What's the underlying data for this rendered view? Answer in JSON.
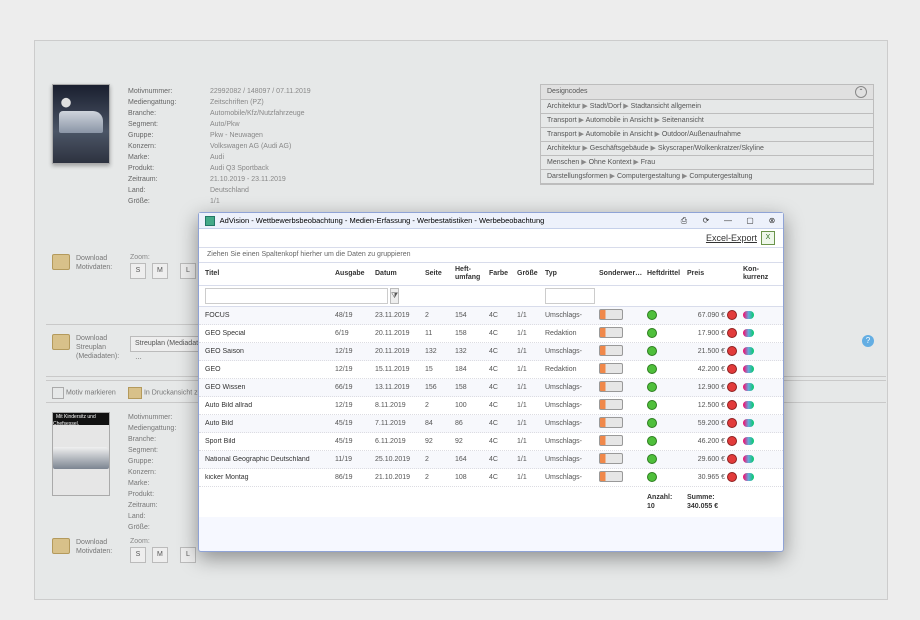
{
  "meta": {
    "labels": [
      "Motivnummer:",
      "Mediengattung:",
      "Branche:",
      "Segment:",
      "Gruppe:",
      "Konzern:",
      "Marke:",
      "Produkt:",
      "Zeitraum:",
      "Land:",
      "Größe:"
    ],
    "values": [
      "22992082 / 148097 / 07.11.2019",
      "Zeitschriften (PZ)",
      "Automobile/Kfz/Nutzfahrzeuge",
      "Auto/Pkw",
      "Pkw - Neuwagen",
      "Volkswagen AG (Audi AG)",
      "Audi",
      "Audi Q3 Sportback",
      "21.10.2019 - 23.11.2019",
      "Deutschland",
      "1/1"
    ]
  },
  "design": {
    "title": "Designcodes",
    "rows": [
      [
        "Architektur",
        "Stadt/Dorf",
        "Stadtansicht allgemein"
      ],
      [
        "Transport",
        "Automobile in Ansicht",
        "Seitenansicht"
      ],
      [
        "Transport",
        "Automobile in Ansicht",
        "Outdoor/Außenaufnahme"
      ],
      [
        "Architektur",
        "Geschäftsgebäude",
        "Skyscraper/Wolkenkratzer/Skyline"
      ],
      [
        "Menschen",
        "Ohne Kontext",
        "Frau"
      ],
      [
        "Darstellungsformen",
        "Computergestaltung",
        "Computergestaltung"
      ]
    ]
  },
  "downloads": {
    "motiv": [
      "Download",
      "Motivdaten:"
    ],
    "streu": [
      "Download",
      "Streuplan",
      "(Mediadaten):"
    ],
    "streu_btn": "Streuplan (Mediadaten) …"
  },
  "zoom": {
    "title": "Zoom:",
    "s": "S",
    "m": "M",
    "l": "L"
  },
  "markbar": {
    "mark": "Motiv markieren",
    "print": "In Druckansicht zeigen"
  },
  "meta2": [
    "Motivnummer:",
    "Mediengattung:",
    "Branche:",
    "Segment:",
    "Gruppe:",
    "Konzern:",
    "Marke:",
    "Produkt:",
    "Zeitraum:",
    "Land:",
    "Größe:"
  ],
  "thumb2_hl": "Mit Kindersitz und Chefsessel.",
  "dialog": {
    "title": "AdVision - Wettbewerbsbeobachtung - Medien-Erfassung - Werbestatistiken - Werbebeobachtung",
    "excel": "Excel-Export",
    "grp": "Ziehen Sie einen Spaltenkopf hierher um die Daten zu gruppieren",
    "cols": [
      "Titel",
      "Ausgabe",
      "Datum",
      "Seite",
      "Heft-umfang",
      "Farbe",
      "Größe",
      "Typ",
      "Sonderwer…",
      "Heftdrittel",
      "Preis",
      "",
      ""
    ],
    "pricecol_hdr": "Preis",
    "lastcol_hdr": "Kon-kurrenz",
    "rows": [
      {
        "t": "FOCUS",
        "a": "48/19",
        "d": "23.11.2019",
        "s": "2",
        "u": "154",
        "f": "4C",
        "g": "1/1",
        "typ": "Umschlags-",
        "p": "67.090 €"
      },
      {
        "t": "GEO Special",
        "a": "6/19",
        "d": "20.11.2019",
        "s": "11",
        "u": "158",
        "f": "4C",
        "g": "1/1",
        "typ": "Redaktion",
        "p": "17.900 €"
      },
      {
        "t": "GEO Saison",
        "a": "12/19",
        "d": "20.11.2019",
        "s": "132",
        "u": "132",
        "f": "4C",
        "g": "1/1",
        "typ": "Umschlags-",
        "p": "21.500 €"
      },
      {
        "t": "GEO",
        "a": "12/19",
        "d": "15.11.2019",
        "s": "15",
        "u": "184",
        "f": "4C",
        "g": "1/1",
        "typ": "Redaktion",
        "p": "42.200 €"
      },
      {
        "t": "GEO Wissen",
        "a": "66/19",
        "d": "13.11.2019",
        "s": "156",
        "u": "158",
        "f": "4C",
        "g": "1/1",
        "typ": "Umschlags-",
        "p": "12.900 €"
      },
      {
        "t": "Auto Bild allrad",
        "a": "12/19",
        "d": "8.11.2019",
        "s": "2",
        "u": "100",
        "f": "4C",
        "g": "1/1",
        "typ": "Umschlags-",
        "p": "12.500 €"
      },
      {
        "t": "Auto Bild",
        "a": "45/19",
        "d": "7.11.2019",
        "s": "84",
        "u": "86",
        "f": "4C",
        "g": "1/1",
        "typ": "Umschlags-",
        "p": "59.200 €"
      },
      {
        "t": "Sport Bild",
        "a": "45/19",
        "d": "6.11.2019",
        "s": "92",
        "u": "92",
        "f": "4C",
        "g": "1/1",
        "typ": "Umschlags-",
        "p": "46.200 €"
      },
      {
        "t": "National Geographic Deutschland",
        "a": "11/19",
        "d": "25.10.2019",
        "s": "2",
        "u": "164",
        "f": "4C",
        "g": "1/1",
        "typ": "Umschlags-",
        "p": "29.600 €"
      },
      {
        "t": "kicker Montag",
        "a": "86/19",
        "d": "21.10.2019",
        "s": "2",
        "u": "108",
        "f": "4C",
        "g": "1/1",
        "typ": "Umschlags-",
        "p": "30.965 €"
      }
    ],
    "footer": {
      "count_lbl": "Anzahl:",
      "count_val": "10",
      "sum_lbl": "Summe:",
      "sum_val": "340.055 €"
    }
  }
}
